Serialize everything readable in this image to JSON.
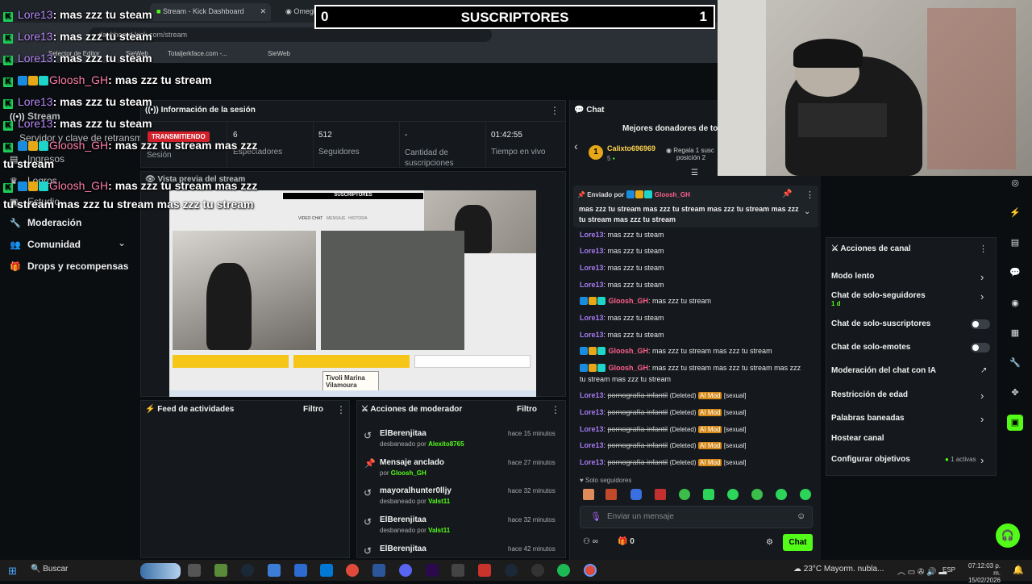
{
  "browser": {
    "tabs": [
      "Stream - Kick Dashboard",
      "Omegle: Habla con Desco..."
    ],
    "address": "dashboard.kick.com/stream",
    "bookmarks": [
      "Selector de Editor",
      "SieWeb",
      "Totaljerkface.com -...",
      "SieWeb"
    ]
  },
  "overlay": {
    "subs_label": "SUSCRIPTORES",
    "subs_left": "0",
    "subs_right": "1",
    "lines": [
      {
        "user": "Lore13",
        "kind": "lore",
        "text": ": mas zzz tu steam"
      },
      {
        "user": "Lore13",
        "kind": "lore",
        "text": ": mas zzz tu steam"
      },
      {
        "user": "Lore13",
        "kind": "lore",
        "text": ": mas zzz tu steam"
      },
      {
        "user": "Gloosh_GH",
        "kind": "glo",
        "text": ": mas zzz tu stream"
      },
      {
        "user": "Lore13",
        "kind": "lore",
        "text": ": mas zzz tu steam"
      },
      {
        "user": "Lore13",
        "kind": "lore",
        "text": ": mas zzz tu steam"
      },
      {
        "user": "Gloosh_GH",
        "kind": "glo",
        "text": ": mas zzz tu stream mas zzz"
      },
      {
        "user": "",
        "kind": "cont",
        "text": "tu stream"
      },
      {
        "user": "Gloosh_GH",
        "kind": "glo",
        "text": ": mas zzz tu stream mas zzz"
      },
      {
        "user": "",
        "kind": "cont",
        "text": "tu stream mas zzz tu stream mas zzz tu stream"
      }
    ]
  },
  "sidebar": {
    "stream": "Stream",
    "server_key": "Servidor y clave de retransm",
    "ingresos": "Ingresos",
    "logros": "Logros",
    "estudio": "Estudio",
    "moderacion": "Moderación",
    "comunidad": "Comunidad",
    "drops": "Drops y recompensas"
  },
  "session": {
    "title": "Información de la sesión",
    "live": "TRANSMITIENDO",
    "stats": [
      {
        "value": "",
        "label": "Sesión"
      },
      {
        "value": "6",
        "label": "Espectadores"
      },
      {
        "value": "512",
        "label": "Seguidores"
      },
      {
        "value": "-",
        "label": "Cantidad de suscripciones"
      },
      {
        "value": "01:42:55",
        "label": "Tiempo en vivo"
      }
    ]
  },
  "preview": {
    "title": "Vista previa del stream",
    "sign": "Tivoli Marina Vilamoura",
    "mini_subs": "SUSCRIPTORES",
    "tabs": [
      "VIDEO CHAT",
      "MENSAJE",
      "HISTORIA"
    ]
  },
  "feed": {
    "title": "Feed de actividades",
    "filter": "Filtro"
  },
  "modactions": {
    "title": "Acciones de moderador",
    "filter": "Filtro",
    "rows": [
      {
        "icon": "undo-icon",
        "title": "ElBerenjitaa",
        "sub_pre": "desbaneado por",
        "by": "Alexito8765",
        "time": "hace 15 minutos"
      },
      {
        "icon": "pin-icon",
        "title": "Mensaje anclado",
        "sub_pre": "por",
        "by": "Gloosh_GH",
        "time": "hace 27 minutos"
      },
      {
        "icon": "undo-icon",
        "title": "mayoralhunter0lljy",
        "sub_pre": "desbaneado por",
        "by": "Valst11",
        "time": "hace 32 minutos"
      },
      {
        "icon": "undo-icon",
        "title": "ElBerenjitaa",
        "sub_pre": "desbaneado por",
        "by": "Valst11",
        "time": "hace 32 minutos"
      },
      {
        "icon": "undo-icon",
        "title": "ElBerenjitaa",
        "sub_pre": "",
        "by": "",
        "time": "hace 42 minutos"
      }
    ]
  },
  "chat": {
    "title": "Chat",
    "donors_title": "Mejores donadores de tod",
    "donor_name": "Calixto696969",
    "donor_count": "5",
    "donor_rank": "1",
    "donor_next": "Regala 1 susc",
    "donor_pos": "posición 2",
    "pinned_by_label": "Enviado por",
    "pinned_by": "Gloosh_GH",
    "pinned_text": "mas zzz tu stream mas zzz tu stream mas zzz tu stream mas zzz tu stream mas zzz tu stream",
    "messages": [
      {
        "user": "Lore13",
        "kind": "lore",
        "text": ": mas zzz tu steam",
        "deleted": false
      },
      {
        "user": "Lore13",
        "kind": "lore",
        "text": ": mas zzz tu steam",
        "deleted": false
      },
      {
        "user": "Lore13",
        "kind": "lore",
        "text": ": mas zzz tu steam",
        "deleted": false
      },
      {
        "user": "Lore13",
        "kind": "lore",
        "text": ": mas zzz tu steam",
        "deleted": false
      },
      {
        "user": "Gloosh_GH",
        "kind": "glo",
        "text": ": mas zzz tu stream",
        "deleted": false
      },
      {
        "user": "Lore13",
        "kind": "lore",
        "text": ": mas zzz tu steam",
        "deleted": false
      },
      {
        "user": "Lore13",
        "kind": "lore",
        "text": ": mas zzz tu steam",
        "deleted": false
      },
      {
        "user": "Gloosh_GH",
        "kind": "glo",
        "text": ": mas zzz tu stream mas zzz tu stream",
        "deleted": false
      },
      {
        "user": "Gloosh_GH",
        "kind": "glo",
        "text": ": mas zzz tu stream mas zzz tu stream mas zzz",
        "cont": "tu stream mas zzz tu stream",
        "deleted": false
      },
      {
        "user": "Lore13",
        "kind": "lore",
        "text": "pornografía infantil",
        "deleted": true
      },
      {
        "user": "Lore13",
        "kind": "lore",
        "text": "pornografía infantil",
        "deleted": true
      },
      {
        "user": "Lore13",
        "kind": "lore",
        "text": "pornografía infantil",
        "deleted": true
      },
      {
        "user": "Lore13",
        "kind": "lore",
        "text": "pornografía infantil",
        "deleted": true
      },
      {
        "user": "Lore13",
        "kind": "lore",
        "text": "pornografía infantil",
        "deleted": true
      }
    ],
    "deleted_label": "(Deleted)",
    "aimod_label": "AI Mod",
    "flag_label": "[sexual]",
    "followers_only": "Solo seguidores",
    "input_placeholder": "Enviar un mensaje",
    "count": "0",
    "send_label": "Chat"
  },
  "channel_actions": {
    "title": "Acciones de canal",
    "items": [
      {
        "label": "Modo lento",
        "type": "chevron"
      },
      {
        "label": "Chat de solo-seguidores",
        "sub": "1 d",
        "type": "chevron"
      },
      {
        "label": "Chat de solo-suscriptores",
        "type": "toggle"
      },
      {
        "label": "Chat de solo-emotes",
        "type": "toggle"
      },
      {
        "label": "Moderación del chat con IA",
        "type": "external"
      },
      {
        "label": "Restricción de edad",
        "type": "chevron"
      },
      {
        "label": "Palabras baneadas",
        "type": "chevron"
      },
      {
        "label": "Hostear canal",
        "type": "none"
      },
      {
        "label": "Configurar objetivos",
        "sub": "1 activas",
        "type": "chevron"
      }
    ]
  },
  "taskbar": {
    "search": "Buscar",
    "weather": "23°C  Mayorm. nubla...",
    "lang": "ESP",
    "time": "07:12:03 p. m.",
    "date": "15/02/2026"
  },
  "colors": {
    "kick_green": "#53fc18",
    "live_red": "#d3202b",
    "lore": "#a57af2",
    "gloosh": "#ff5f8c"
  }
}
